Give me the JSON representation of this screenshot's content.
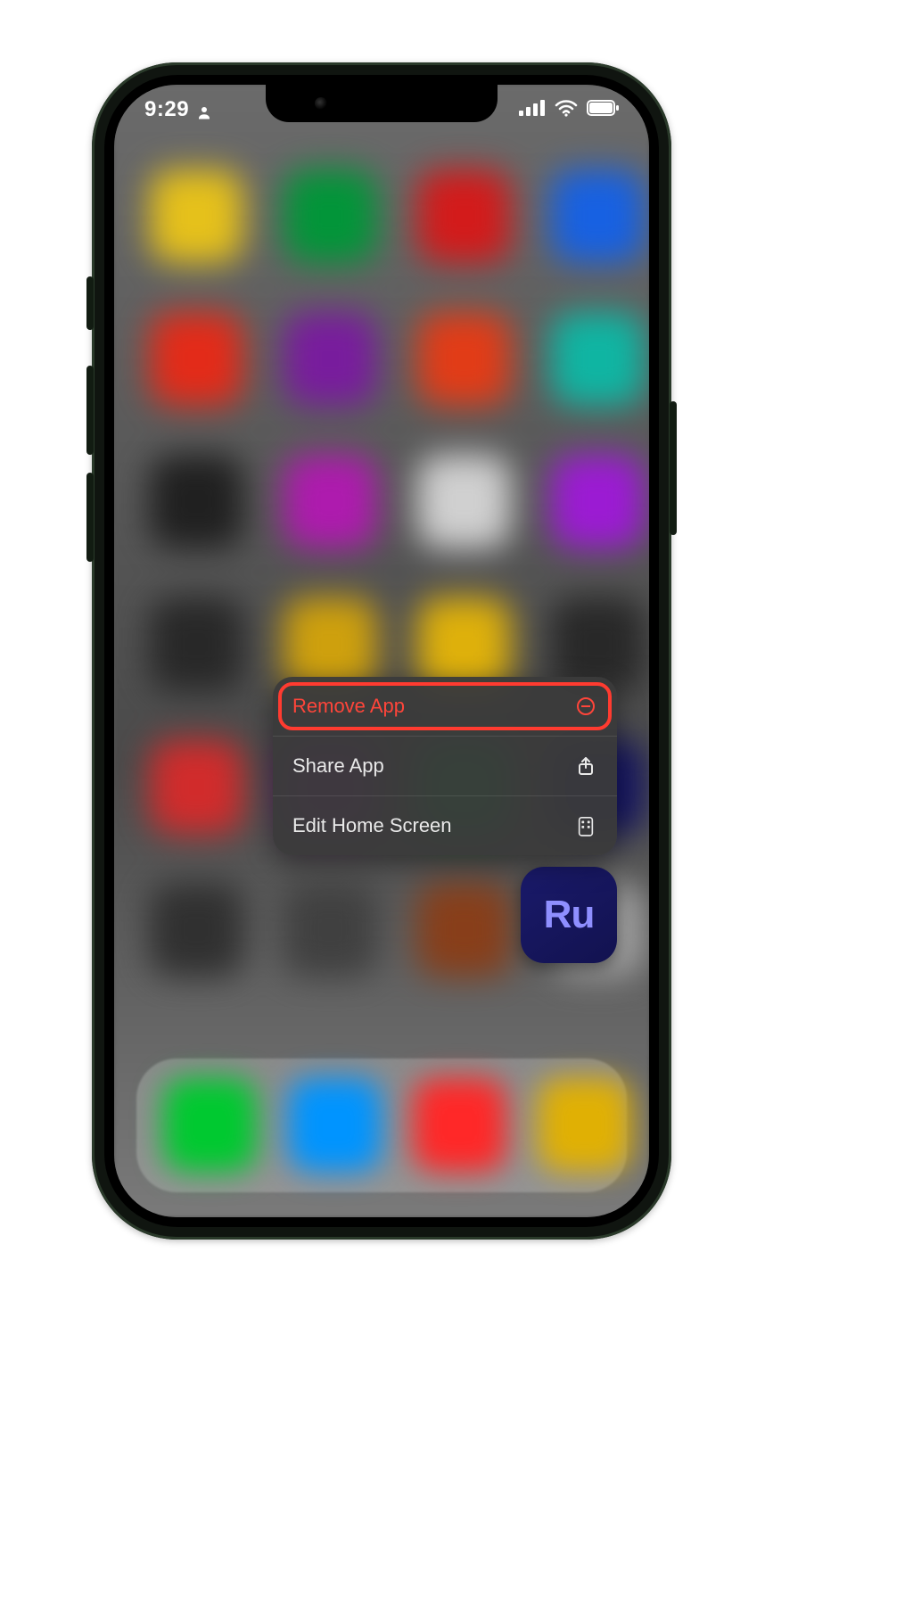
{
  "status": {
    "time": "9:29",
    "person_indicator": true,
    "cellular_bars": 4,
    "wifi": true,
    "battery_pct": 95
  },
  "focused_app": {
    "name": "Adobe Premiere Rush",
    "short_label": "Ru",
    "icon_bg": "#16165a",
    "icon_fg": "#8f8fff"
  },
  "context_menu": {
    "items": [
      {
        "label": "Remove App",
        "icon": "minus-circle-icon",
        "destructive": true,
        "highlighted": true
      },
      {
        "label": "Share App",
        "icon": "share-icon",
        "destructive": false,
        "highlighted": false
      },
      {
        "label": "Edit Home Screen",
        "icon": "apps-grid-icon",
        "destructive": false,
        "highlighted": false
      }
    ]
  },
  "background_grid": {
    "rows": 6,
    "cols": 4,
    "colors": [
      [
        "#e0c030",
        "#109040",
        "#c02020",
        "#2060d0"
      ],
      [
        "#d03020",
        "#702090",
        "#d04020",
        "#20b0a0"
      ],
      [
        "#202020",
        "#a020a0",
        "#d0d0d0",
        "#9020c0"
      ],
      [
        "#282828",
        "#c8a020",
        "#d8b020",
        "#282828"
      ],
      [
        "#c03030",
        "#702080",
        "#109040",
        "#16165a"
      ],
      [
        "#303030",
        "#404040",
        "#804020",
        "#a0a0a0"
      ]
    ]
  },
  "dock": {
    "colors": [
      "#10c040",
      "#1090f0",
      "#f03030",
      "#d8b020"
    ]
  }
}
